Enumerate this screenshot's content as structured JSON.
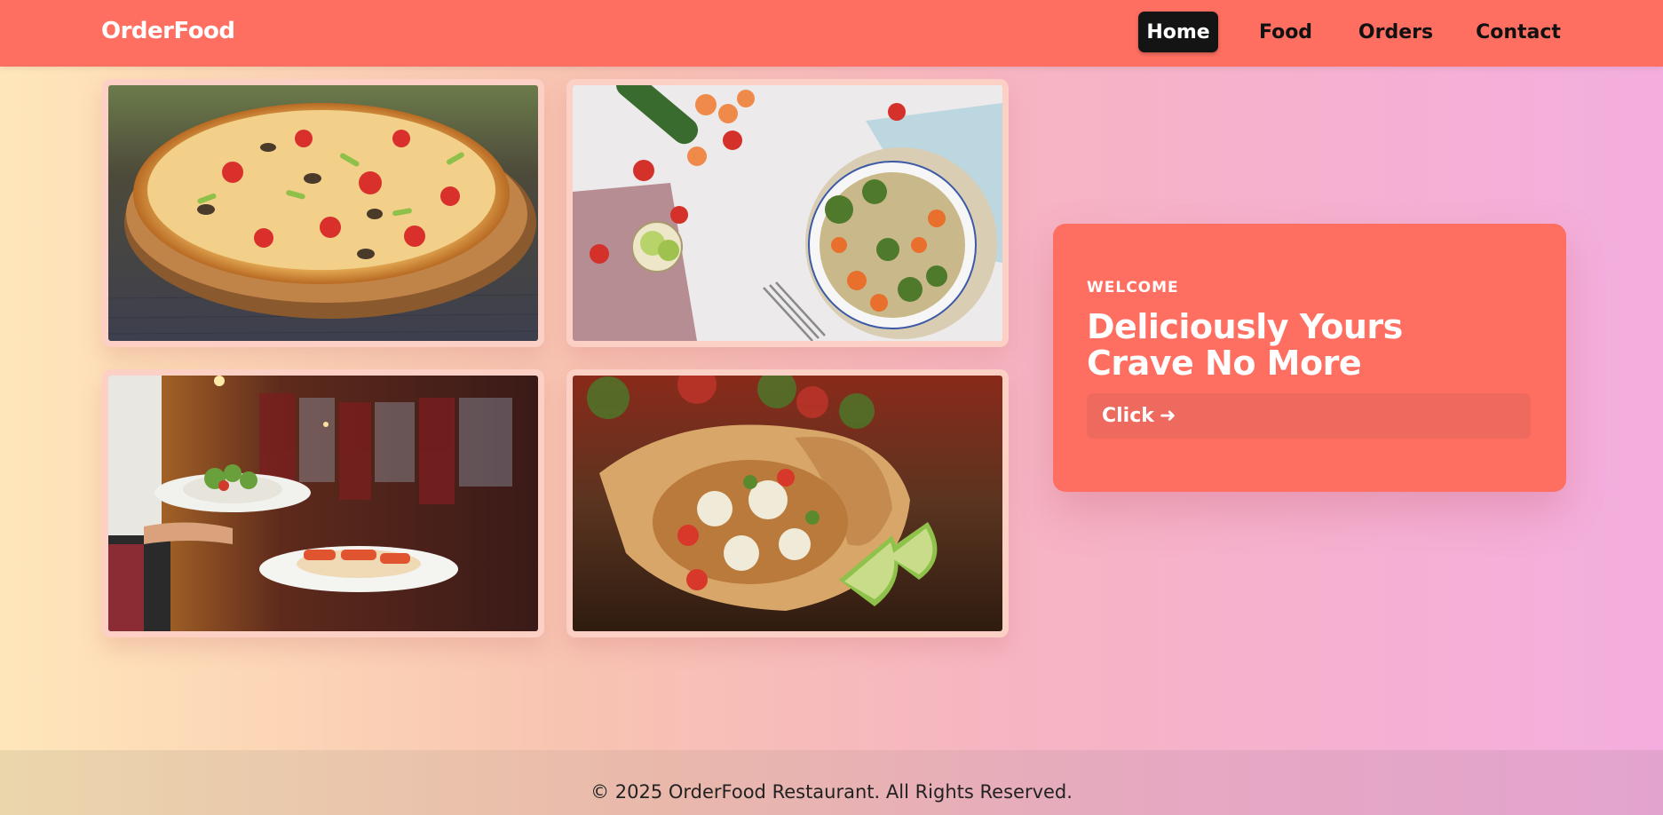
{
  "header": {
    "logo": "OrderFood",
    "nav": [
      {
        "label": "Home",
        "active": true
      },
      {
        "label": "Food",
        "active": false
      },
      {
        "label": "Orders",
        "active": false
      },
      {
        "label": "Contact",
        "active": false
      }
    ]
  },
  "gallery": [
    {
      "subject": "pizza"
    },
    {
      "subject": "salad-bowl-vegetables"
    },
    {
      "subject": "waiter-serving-plates"
    },
    {
      "subject": "burrito"
    }
  ],
  "hero": {
    "kicker": "WELCOME",
    "title_line1": "Deliciously Yours",
    "title_line2": "Crave No More",
    "button_label": "Click",
    "button_icon": "arrow-right-icon"
  },
  "footer": {
    "text": "© 2025 OrderFood Restaurant. All Rights Reserved."
  },
  "colors": {
    "accent": "#ff6f61",
    "nav_active_bg": "#141414"
  }
}
